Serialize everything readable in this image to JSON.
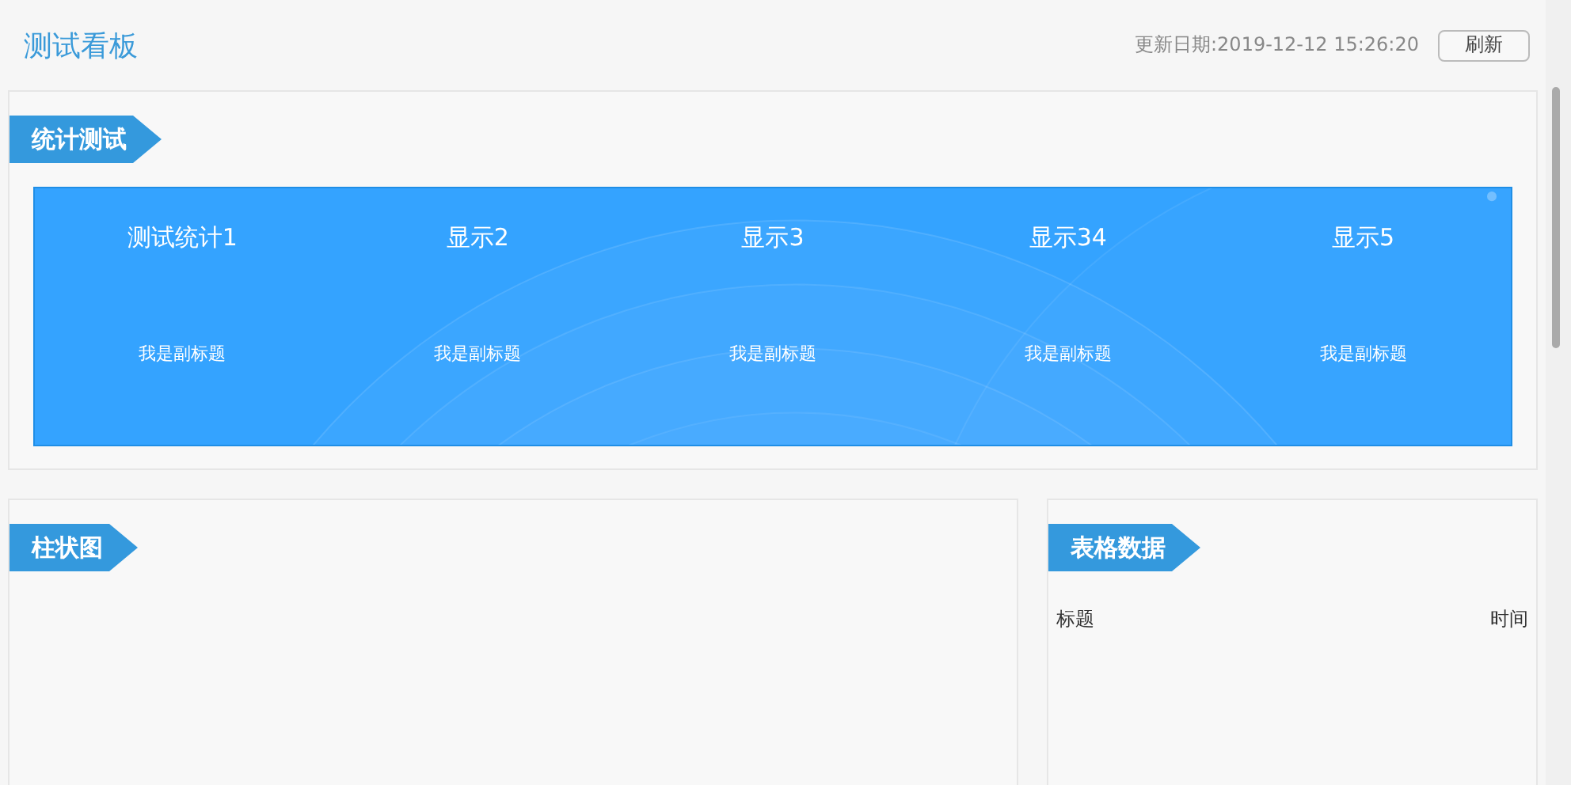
{
  "header": {
    "title": "测试看板",
    "update_label": "更新日期:2019-12-12 15:26:20",
    "refresh_button": "刷新"
  },
  "stats_panel": {
    "tag": "统计测试",
    "items": [
      {
        "title": "测试统计1",
        "subtitle": "我是副标题"
      },
      {
        "title": "显示2",
        "subtitle": "我是副标题"
      },
      {
        "title": "显示3",
        "subtitle": "我是副标题"
      },
      {
        "title": "显示34",
        "subtitle": "我是副标题"
      },
      {
        "title": "显示5",
        "subtitle": "我是副标题"
      }
    ]
  },
  "bar_panel": {
    "tag": "柱状图"
  },
  "table_panel": {
    "tag": "表格数据",
    "columns": [
      "标题",
      "时间"
    ]
  }
}
